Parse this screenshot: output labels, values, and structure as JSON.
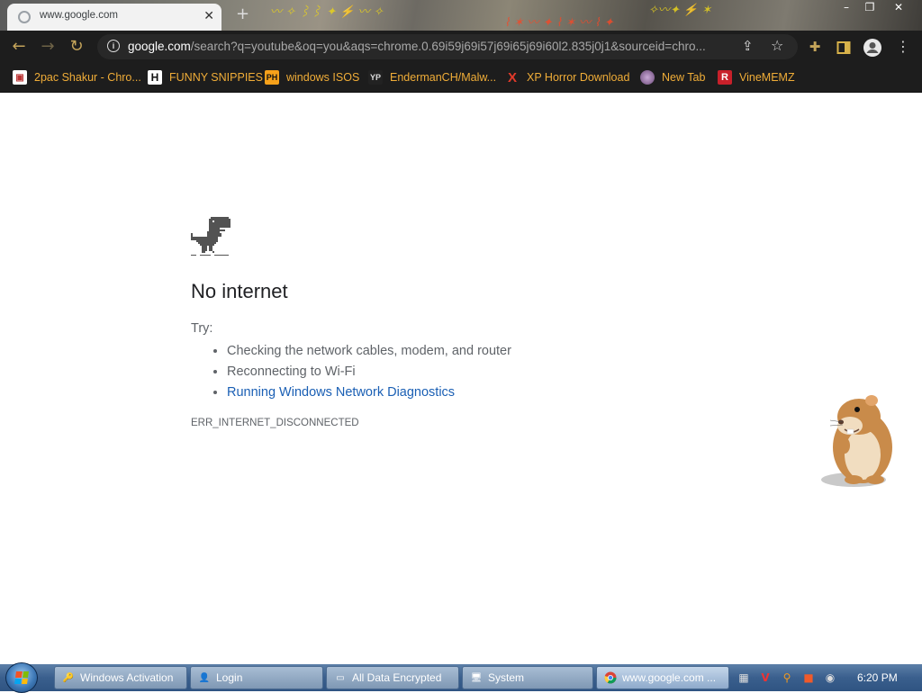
{
  "browser": {
    "tab_title": "www.google.com",
    "url_host": "google.com",
    "url_rest": "/search?q=youtube&oq=you&aqs=chrome.0.69i59j69i57j69i65j69i60l2.835j0j1&sourceid=chro...",
    "bookmarks": [
      {
        "label": "2pac Shakur - Chro...",
        "icon": "box-icon"
      },
      {
        "label": "FUNNY SNIPPIES",
        "icon": "h-icon"
      },
      {
        "label": "windows ISOS",
        "icon": "ph-icon"
      },
      {
        "label": "EndermanCH/Malw...",
        "icon": "yp-icon"
      },
      {
        "label": "XP Horror Download",
        "icon": "x-icon"
      },
      {
        "label": "New Tab",
        "icon": "globe-icon"
      },
      {
        "label": "VineMEMZ",
        "icon": "r-icon"
      }
    ]
  },
  "page": {
    "heading": "No internet",
    "try_label": "Try:",
    "suggestions": [
      "Checking the network cables, modem, and router",
      "Reconnecting to Wi-Fi",
      "Running Windows Network Diagnostics"
    ],
    "error_code": "ERR_INTERNET_DISCONNECTED"
  },
  "taskbar": {
    "items": [
      {
        "label": "Windows Activation",
        "icon": "key-icon"
      },
      {
        "label": "Login",
        "icon": "user-icon"
      },
      {
        "label": "All Data Encrypted",
        "icon": "window-icon"
      },
      {
        "label": "System",
        "icon": "system-icon"
      },
      {
        "label": "www.google.com ...",
        "icon": "chrome-icon"
      }
    ],
    "clock": "6:20 PM"
  },
  "colors": {
    "bookmark_text": "#f0ad38",
    "link": "#1a5fb4",
    "toolbar_bg": "#1d1d1d"
  }
}
